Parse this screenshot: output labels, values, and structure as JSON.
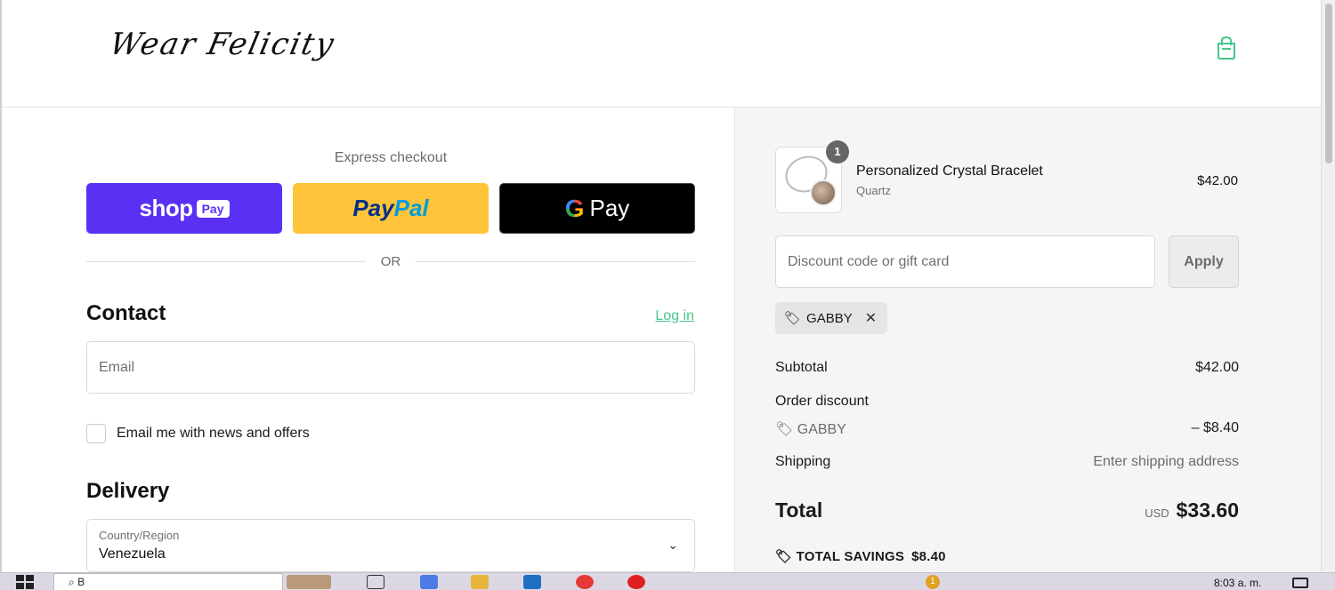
{
  "header": {
    "logo_text": "Wear Felicity",
    "cart_icon": "shopping-bag-icon",
    "accent_color": "#45c88b"
  },
  "express": {
    "title": "Express checkout",
    "shop_pay_word": "shop",
    "shop_pay_pill": "Pay",
    "paypal_left": "Pay",
    "paypal_right": "Pal",
    "gpay_g": "G",
    "gpay_text": "Pay",
    "or_text": "OR"
  },
  "contact": {
    "title": "Contact",
    "login_label": "Log in",
    "email_placeholder": "Email",
    "newsletter_label": "Email me with news and offers"
  },
  "delivery": {
    "title": "Delivery",
    "country_label": "Country/Region",
    "country_value": "Venezuela"
  },
  "summary": {
    "item": {
      "quantity": "1",
      "name": "Personalized Crystal Bracelet",
      "variant": "Quartz",
      "price": "$42.00"
    },
    "discount_placeholder": "Discount code or gift card",
    "apply_label": "Apply",
    "applied_code": "GABBY",
    "subtotal_label": "Subtotal",
    "subtotal_value": "$42.00",
    "order_discount_label": "Order discount",
    "discount_code": "GABBY",
    "discount_value": "– $8.40",
    "shipping_label": "Shipping",
    "shipping_value": "Enter shipping address",
    "total_label": "Total",
    "currency": "USD",
    "total_value": "$33.60",
    "savings_label": "TOTAL SAVINGS",
    "savings_value": "$8.40"
  },
  "taskbar": {
    "search_text": "B",
    "clock": "8:03 a. m.",
    "notification_count": "1"
  }
}
